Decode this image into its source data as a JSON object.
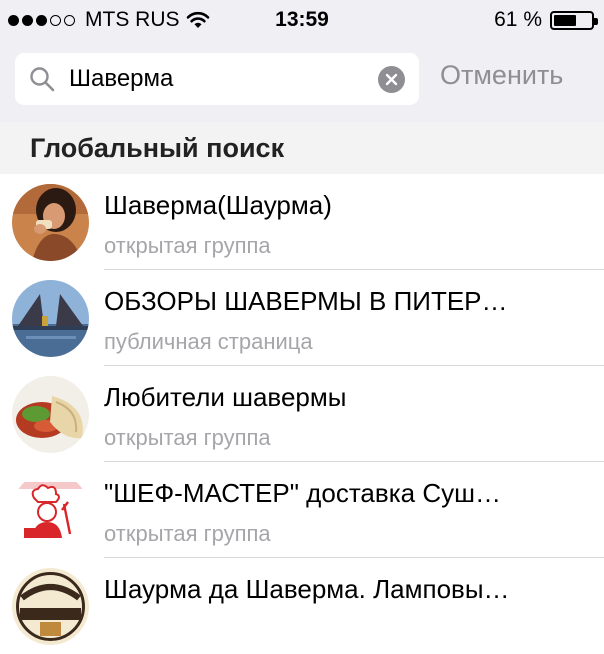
{
  "status": {
    "carrier": "MTS RUS",
    "time": "13:59",
    "battery": "61 %",
    "battery_level": 0.61,
    "signal_dots": [
      true,
      true,
      true,
      false,
      false
    ]
  },
  "search": {
    "value": "Шаверма",
    "cancel_label": "Отменить"
  },
  "section": {
    "title": "Глобальный поиск"
  },
  "results": [
    {
      "name": "Шаверма(Шаурма)",
      "subtitle": "открытая группа",
      "avatar": "woman-eating-photo"
    },
    {
      "name": "ОБЗОРЫ ШАВЕРМЫ В ПИТЕР…",
      "subtitle": "публичная страница",
      "avatar": "city-bridge-photo"
    },
    {
      "name": "Любители шавермы",
      "subtitle": "открытая группа",
      "avatar": "shawarma-photo"
    },
    {
      "name": "\"ШЕФ-МАСТЕР\" доставка Суш…",
      "subtitle": "открытая группа",
      "avatar": "chef-logo"
    },
    {
      "name": "Шаурма да Шаверма. Ламповы…",
      "subtitle": "",
      "avatar": "worlds-best-shawarma-logo"
    }
  ],
  "colors": {
    "header_bg": "#efeff4",
    "section_bg": "#f3f3f3",
    "secondary_text": "#a6a6aa",
    "cancel_text": "#8e8e93"
  }
}
